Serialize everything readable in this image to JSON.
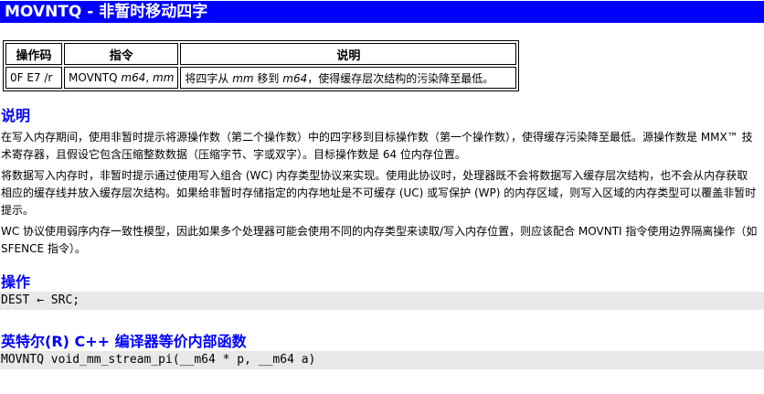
{
  "title": "MOVNTQ - 非暂时移动四字",
  "table": {
    "headers": [
      "操作码",
      "指令",
      "说明"
    ],
    "row": {
      "opcode": "0F E7 /r",
      "instr_mnemonic": "MOVNTQ",
      "instr_op1": "m64",
      "instr_sep": ", ",
      "instr_op2": "mm",
      "desc_a": "将四字从 ",
      "desc_mm": "mm",
      "desc_b": " 移到 ",
      "desc_m64": "m64",
      "desc_c": "，使得缓存层次结构的污染降至最低。"
    }
  },
  "description": {
    "heading": "说明",
    "paragraphs": [
      "在写入内存期间，使用非暂时提示将源操作数（第二个操作数）中的四字移到目标操作数（第一个操作数），使得缓存污染降至最低。源操作数是 MMX™ 技术寄存器，且假设它包含压缩整数数据（压缩字节、字或双字）。目标操作数是 64 位内存位置。",
      "将数据写入内存时，非暂时提示通过使用写入组合 (WC) 内存类型协议来实现。使用此协议时，处理器既不会将数据写入缓存层次结构，也不会从内存获取相应的缓存线并放入缓存层次结构。如果给非暂时存储指定的内存地址是不可缓存 (UC) 或写保护 (WP) 的内存区域，则写入区域的内存类型可以覆盖非暂时提示。",
      "WC 协议使用弱序内存一致性模型，因此如果多个处理器可能会使用不同的内存类型来读取/写入内存位置，则应该配合 MOVNTI 指令使用边界隔离操作（如 SFENCE 指令）。"
    ]
  },
  "operation": {
    "heading": "操作",
    "code": "DEST ← SRC;"
  },
  "intrinsic": {
    "heading": "英特尔(R) C++ 编译器等价内部函数",
    "code": "MOVNTQ void_mm_stream_pi(__m64 * p, __m64 a)"
  }
}
